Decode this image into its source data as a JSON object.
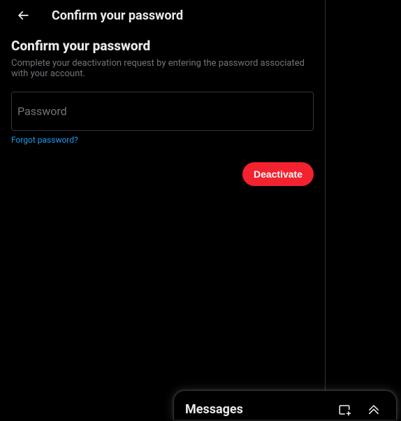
{
  "header": {
    "title": "Confirm your password"
  },
  "content": {
    "section_title": "Confirm your password",
    "description": "Complete your deactivation request by entering the password associated with your account.",
    "password_label": "Password",
    "password_value": "",
    "forgot_link": "Forgot password?"
  },
  "actions": {
    "deactivate_label": "Deactivate"
  },
  "messages": {
    "title": "Messages"
  }
}
